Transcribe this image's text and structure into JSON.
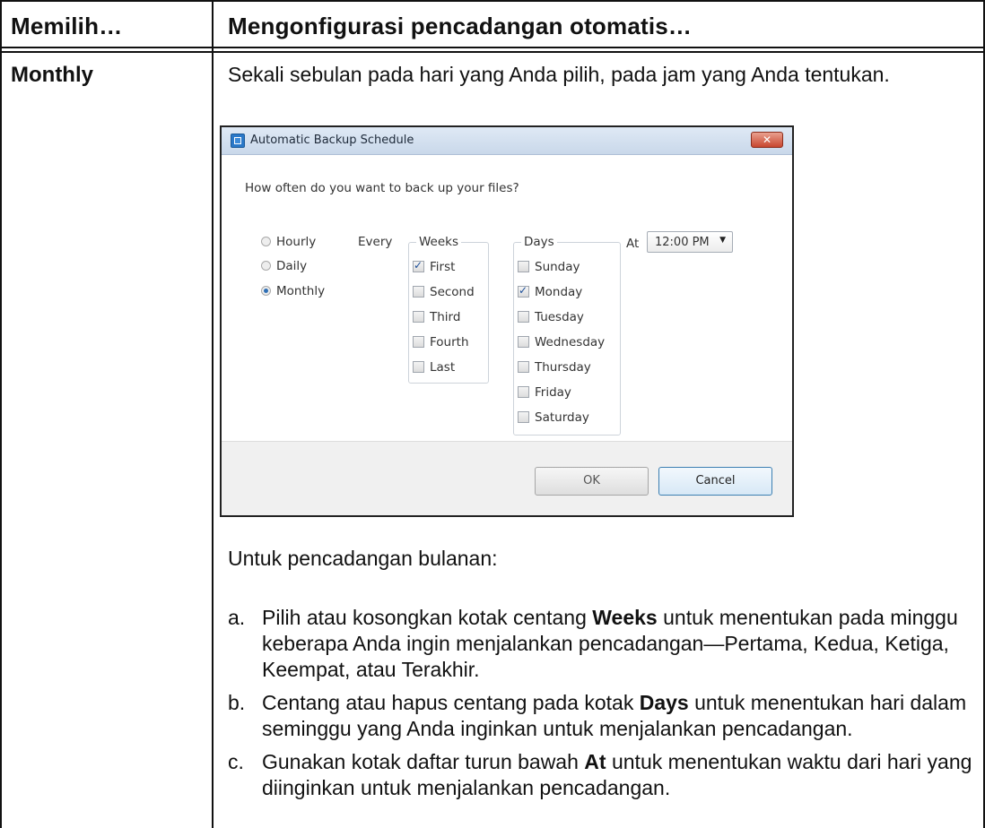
{
  "header": {
    "col1": "Memilih…",
    "col2": "Mengonfigurasi pencadangan otomatis…"
  },
  "row": {
    "label": "Monthly",
    "description": "Sekali sebulan pada hari yang Anda pilih, pada jam yang Anda tentukan."
  },
  "dialog": {
    "title": "Automatic Backup Schedule",
    "close_label": "✕",
    "question": "How often do you want to back up your files?",
    "frequency": [
      {
        "label": "Hourly",
        "selected": false
      },
      {
        "label": "Daily",
        "selected": false
      },
      {
        "label": "Monthly",
        "selected": true
      }
    ],
    "every_label": "Every",
    "weeks_label": "Weeks",
    "weeks": [
      {
        "label": "First",
        "checked": true
      },
      {
        "label": "Second",
        "checked": false
      },
      {
        "label": "Third",
        "checked": false
      },
      {
        "label": "Fourth",
        "checked": false
      },
      {
        "label": "Last",
        "checked": false
      }
    ],
    "days_label": "Days",
    "days": [
      {
        "label": "Sunday",
        "checked": false
      },
      {
        "label": "Monday",
        "checked": true
      },
      {
        "label": "Tuesday",
        "checked": false
      },
      {
        "label": "Wednesday",
        "checked": false
      },
      {
        "label": "Thursday",
        "checked": false
      },
      {
        "label": "Friday",
        "checked": false
      },
      {
        "label": "Saturday",
        "checked": false
      }
    ],
    "at_label": "At",
    "time_value": "12:00 PM",
    "ok_label": "OK",
    "cancel_label": "Cancel"
  },
  "after_text": "Untuk pencadangan bulanan:",
  "steps": [
    {
      "letter": "a.",
      "pre": "Pilih atau kosongkan kotak centang ",
      "bold": "Weeks",
      "post": " untuk menentukan pada minggu keberapa Anda ingin menjalankan pencadangan—Pertama, Kedua, Ketiga, Keempat, atau Terakhir."
    },
    {
      "letter": "b.",
      "pre": "Centang atau hapus centang pada kotak ",
      "bold": "Days",
      "post": " untuk menentukan hari dalam seminggu yang Anda inginkan untuk menjalankan pencadangan."
    },
    {
      "letter": "c.",
      "pre": "Gunakan kotak daftar turun bawah ",
      "bold": "At",
      "post": " untuk menentukan waktu dari hari yang diinginkan untuk menjalankan pencadangan."
    }
  ]
}
